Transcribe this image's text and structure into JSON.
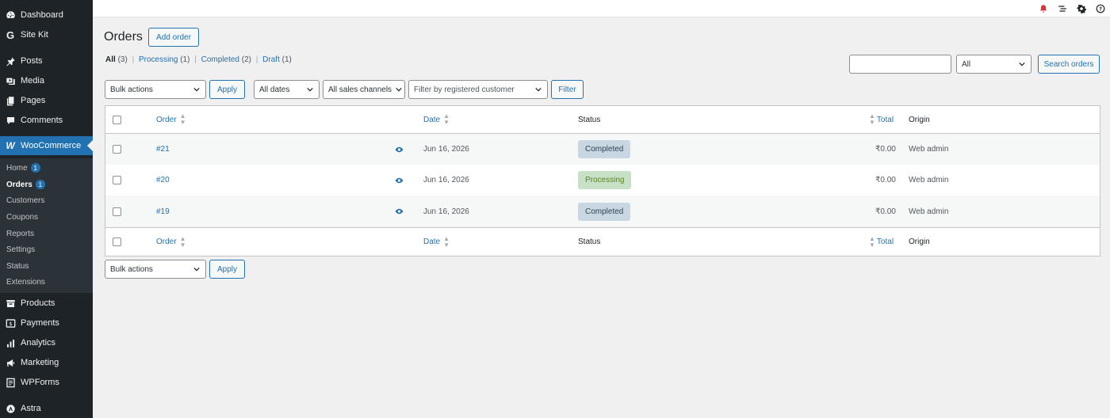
{
  "sidebar": {
    "menu": [
      {
        "label": "Dashboard",
        "icon": "dashboard-icon"
      },
      {
        "label": "Site Kit",
        "icon": "google-g-icon"
      },
      {
        "label": "Posts",
        "icon": "pin-icon"
      },
      {
        "label": "Media",
        "icon": "media-icon"
      },
      {
        "label": "Pages",
        "icon": "pages-icon"
      },
      {
        "label": "Comments",
        "icon": "comment-icon"
      },
      {
        "label": "WooCommerce",
        "icon": "woo-icon"
      },
      {
        "label": "Products",
        "icon": "archive-icon"
      },
      {
        "label": "Payments",
        "icon": "dollar-icon"
      },
      {
        "label": "Analytics",
        "icon": "bar-chart-icon"
      },
      {
        "label": "Marketing",
        "icon": "megaphone-icon"
      },
      {
        "label": "WPForms",
        "icon": "form-icon"
      },
      {
        "label": "Astra",
        "icon": "astra-icon"
      }
    ],
    "submenu": [
      {
        "label": "Home",
        "badge": "1"
      },
      {
        "label": "Orders",
        "badge": "1"
      },
      {
        "label": "Customers"
      },
      {
        "label": "Coupons"
      },
      {
        "label": "Reports"
      },
      {
        "label": "Settings"
      },
      {
        "label": "Status"
      },
      {
        "label": "Extensions"
      }
    ]
  },
  "page": {
    "title": "Orders",
    "add_order": "Add order"
  },
  "views": {
    "all": {
      "label": "All",
      "count": "(3)"
    },
    "processing": {
      "label": "Processing",
      "count": "(1)"
    },
    "completed": {
      "label": "Completed",
      "count": "(2)"
    },
    "draft": {
      "label": "Draft",
      "count": "(1)"
    },
    "separator": "|"
  },
  "search": {
    "value": "",
    "status_select": "All",
    "button": "Search orders"
  },
  "filters": {
    "bulk_actions": "Bulk actions",
    "apply": "Apply",
    "dates": "All dates",
    "channels": "All sales channels",
    "customer_placeholder": "Filter by registered customer",
    "filter": "Filter"
  },
  "table": {
    "columns": {
      "order": "Order",
      "date": "Date",
      "status": "Status",
      "total": "Total",
      "origin": "Origin"
    },
    "rows": [
      {
        "order": "#21",
        "date": "Jun 16, 2026",
        "status": "Completed",
        "total": "₹0.00",
        "origin": "Web admin"
      },
      {
        "order": "#20",
        "date": "Jun 16, 2026",
        "status": "Processing",
        "total": "₹0.00",
        "origin": "Web admin"
      },
      {
        "order": "#19",
        "date": "Jun 16, 2026",
        "status": "Completed",
        "total": "₹0.00",
        "origin": "Web admin"
      }
    ]
  },
  "bottom": {
    "bulk_actions": "Bulk actions",
    "apply": "Apply"
  },
  "colors": {
    "sidebar_bg": "#1d2327",
    "accent": "#2271b1",
    "completed_bg": "#c8d7e1",
    "processing_bg": "#c6e1c6"
  }
}
